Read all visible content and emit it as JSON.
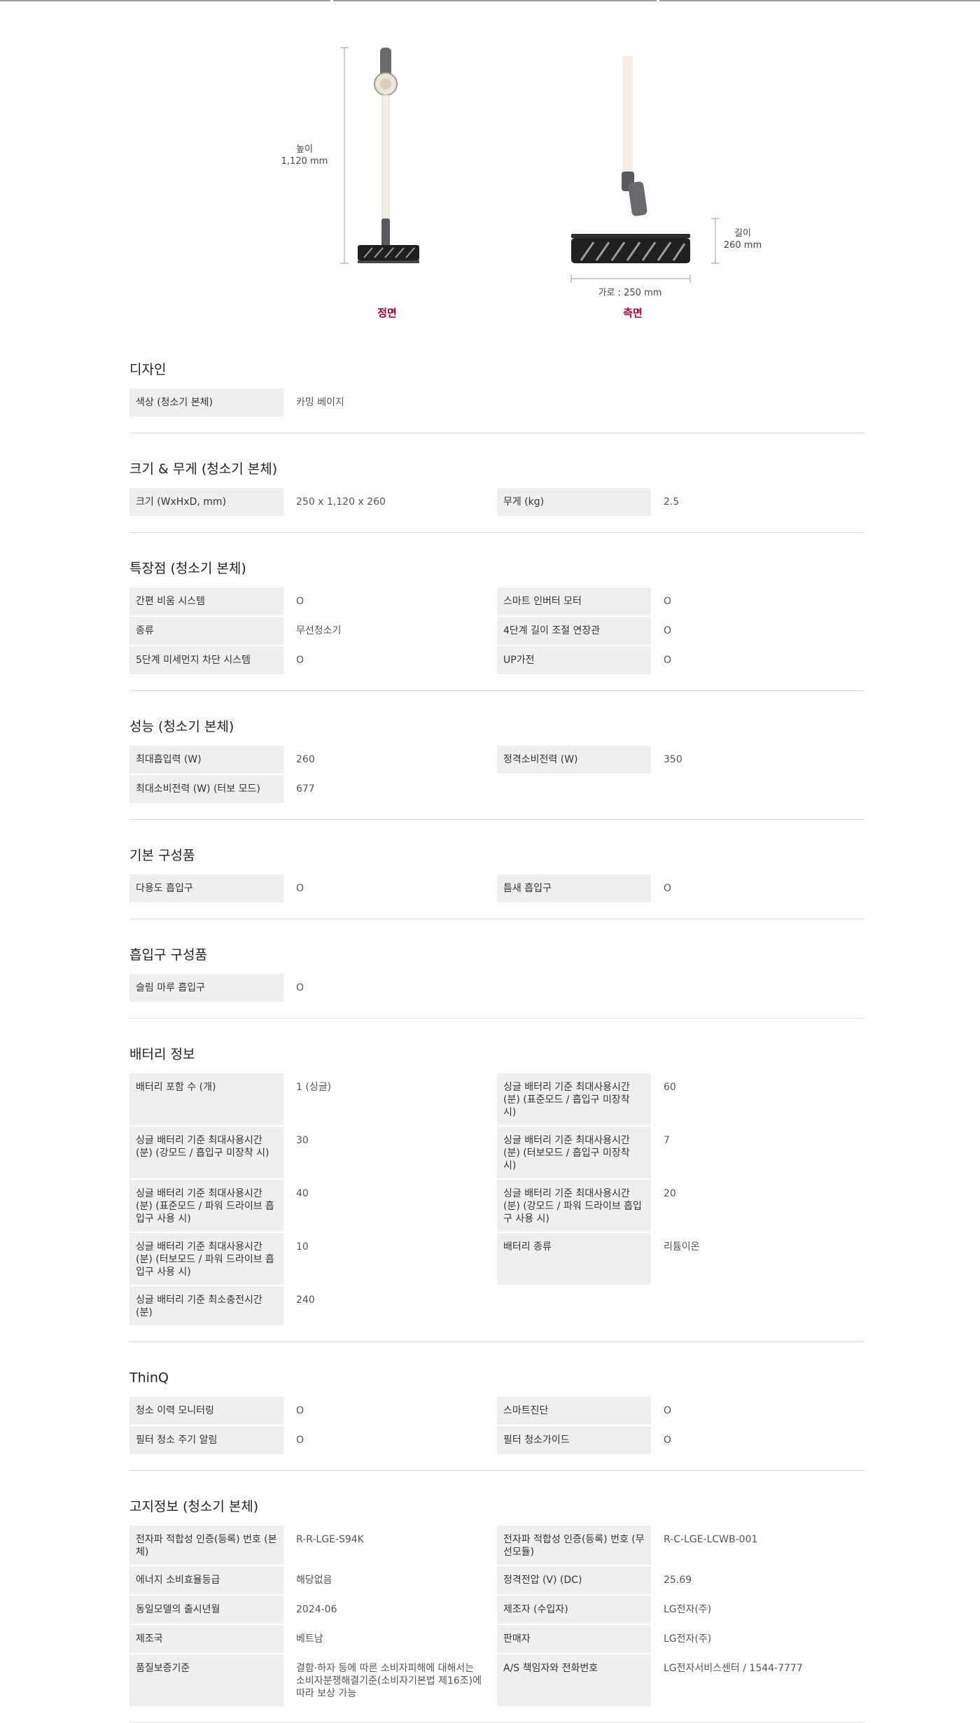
{
  "dimensions": {
    "height_label": "높이",
    "height_value": "1,120 mm",
    "length_label": "길이",
    "length_value": "260 mm",
    "width_text": "가로 : 250 mm",
    "front_label": "정면",
    "side_label": "측면"
  },
  "sections": [
    {
      "title": "디자인",
      "rows": [
        [
          {
            "label": "색상 (청소기 본체)",
            "value": "카밍 베이지"
          }
        ]
      ]
    },
    {
      "title": "크기 & 무게 (청소기 본체)",
      "rows": [
        [
          {
            "label": "크기 (WxHxD, mm)",
            "value": "250 x 1,120 x 260"
          },
          {
            "label": "무게 (kg)",
            "value": "2.5"
          }
        ]
      ]
    },
    {
      "title": "특장점 (청소기 본체)",
      "rows": [
        [
          {
            "label": "간편 비움 시스템",
            "value": "O"
          },
          {
            "label": "스마트 인버터 모터",
            "value": "O"
          }
        ],
        [
          {
            "label": "종류",
            "value": "무선청소기"
          },
          {
            "label": "4단계 길이 조절 연장관",
            "value": "O"
          }
        ],
        [
          {
            "label": "5단계 미세먼지 차단 시스템",
            "value": "O"
          },
          {
            "label": "UP가전",
            "value": "O"
          }
        ]
      ]
    },
    {
      "title": "성능 (청소기 본체)",
      "rows": [
        [
          {
            "label": "최대흡입력 (W)",
            "value": "260"
          },
          {
            "label": "정격소비전력 (W)",
            "value": "350"
          }
        ],
        [
          {
            "label": "최대소비전력 (W) (터보 모드)",
            "value": "677"
          }
        ]
      ]
    },
    {
      "title": "기본 구성품",
      "rows": [
        [
          {
            "label": "다용도 흡입구",
            "value": "O"
          },
          {
            "label": "틈새 흡입구",
            "value": "O"
          }
        ]
      ]
    },
    {
      "title": "흡입구 구성품",
      "rows": [
        [
          {
            "label": "슬림 마루 흡입구",
            "value": "O"
          }
        ]
      ]
    },
    {
      "title": "배터리 정보",
      "rows": [
        [
          {
            "label": "배터리 포함 수 (개)",
            "value": "1 (싱글)"
          },
          {
            "label": "싱글 배터리 기준 최대사용시간 (분) (표준모드 / 흡입구 미장착 시)",
            "value": "60"
          }
        ],
        [
          {
            "label": "싱글 배터리 기준 최대사용시간 (분) (강모드 / 흡입구 미장착 시)",
            "value": "30"
          },
          {
            "label": "싱글 배터리 기준 최대사용시간 (분) (터보모드 / 흡입구 미장착 시)",
            "value": "7"
          }
        ],
        [
          {
            "label": "싱글 배터리 기준 최대사용시간 (분) (표준모드 / 파워 드라이브 흡입구 사용 시)",
            "value": "40"
          },
          {
            "label": "싱글 배터리 기준 최대사용시간 (분) (강모드 / 파워 드라이브 흡입구 사용 시)",
            "value": "20"
          }
        ],
        [
          {
            "label": "싱글 배터리 기준 최대사용시간 (분) (터보모드 / 파워 드라이브 흡입구 사용 시)",
            "value": "10"
          },
          {
            "label": "배터리 종류",
            "value": "리튬이온"
          }
        ],
        [
          {
            "label": "싱글 배터리 기준 최소충전시간 (분)",
            "value": "240"
          }
        ]
      ]
    },
    {
      "title": "ThinQ",
      "rows": [
        [
          {
            "label": "청소 이력 모니터링",
            "value": "O"
          },
          {
            "label": "스마트진단",
            "value": "O"
          }
        ],
        [
          {
            "label": "필터 청소 주기 알림",
            "value": "O"
          },
          {
            "label": "필터 청소가이드",
            "value": "O"
          }
        ]
      ]
    },
    {
      "title": "고지정보 (청소기 본체)",
      "rows": [
        [
          {
            "label": "전자파 적합성 인증(등록) 번호 (본체)",
            "value": "R-R-LGE-S94K"
          },
          {
            "label": "전자파 적합성 인증(등록) 번호 (무선모듈)",
            "value": "R-C-LGE-LCWB-001"
          }
        ],
        [
          {
            "label": "에너지 소비효율등급",
            "value": "해당없음"
          },
          {
            "label": "정격전압 (V) (DC)",
            "value": "25.69"
          }
        ],
        [
          {
            "label": "동일모델의 출시년월",
            "value": "2024-06"
          },
          {
            "label": "제조자 (수입자)",
            "value": "LG전자(주)"
          }
        ],
        [
          {
            "label": "제조국",
            "value": "베트남"
          },
          {
            "label": "판매자",
            "value": "LG전자(주)"
          }
        ],
        [
          {
            "label": "품질보증기준",
            "value": "결함·하자 등에 따른 소비자피해에 대해서는 소비자분쟁해결기준(소비자기본법 제16조)에 따라 보상 가능"
          },
          {
            "label": "A/S 책임자와 전화번호",
            "value": "LG전자서비스센터 / 1544-7777"
          }
        ]
      ]
    }
  ]
}
